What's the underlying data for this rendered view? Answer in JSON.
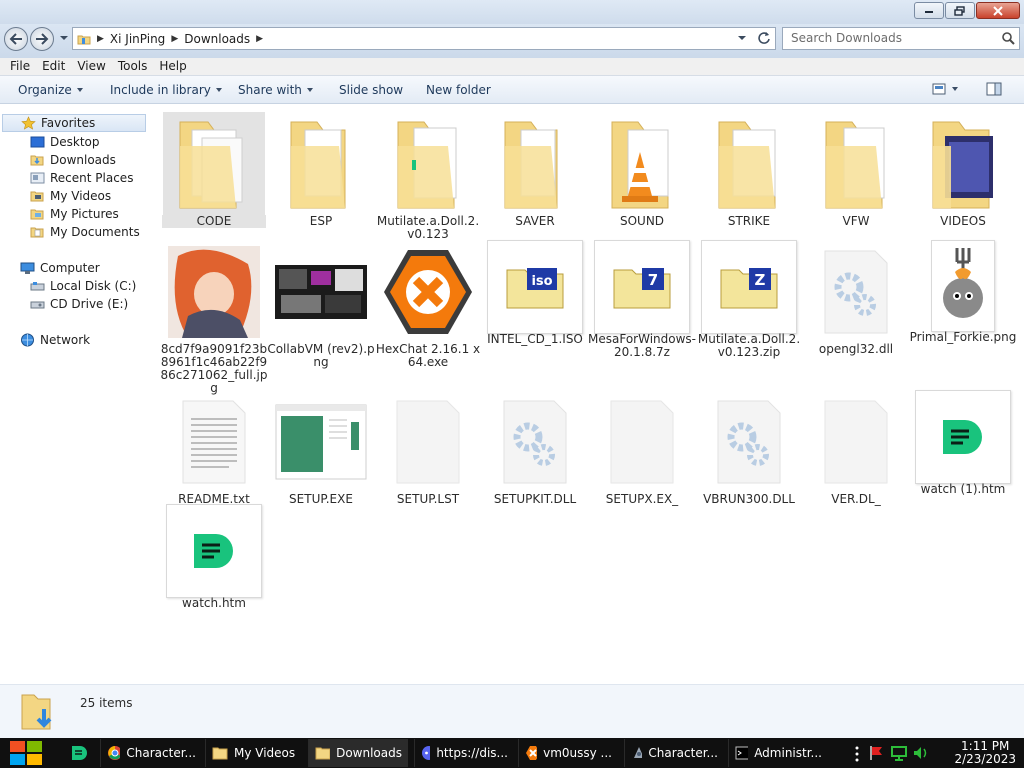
{
  "window": {
    "buttons": [
      "minimize",
      "restore",
      "close"
    ]
  },
  "address": {
    "crumbs": [
      "Xi JinPing",
      "Downloads"
    ],
    "search_placeholder": "Search Downloads"
  },
  "menu": [
    "File",
    "Edit",
    "View",
    "Tools",
    "Help"
  ],
  "commands": {
    "organize": "Organize",
    "include": "Include in library",
    "share": "Share with",
    "slideshow": "Slide show",
    "newfolder": "New folder"
  },
  "nav": {
    "favorites": "Favorites",
    "desktop": "Desktop",
    "downloads": "Downloads",
    "recent": "Recent Places",
    "videos": "My Videos",
    "pictures": "My Pictures",
    "documents": "My Documents",
    "computer": "Computer",
    "localdisk": "Local Disk (C:)",
    "cddrive": "CD Drive (E:)",
    "network": "Network"
  },
  "files": [
    {
      "name": "CODE",
      "icon": "folder-icon"
    },
    {
      "name": "ESP",
      "icon": "folder-icon"
    },
    {
      "name": "Mutilate.a.Doll.2.v0.123",
      "icon": "folder-icon"
    },
    {
      "name": "SAVER",
      "icon": "folder-icon"
    },
    {
      "name": "SOUND",
      "icon": "folder-vlc-icon"
    },
    {
      "name": "STRIKE",
      "icon": "folder-icon"
    },
    {
      "name": "VFW",
      "icon": "folder-icon"
    },
    {
      "name": "VIDEOS",
      "icon": "folder-video-icon"
    },
    {
      "name": "8cd7f9a9091f23b8961f1c46ab22f986c271062_full.jpg",
      "icon": "image-thumbnail"
    },
    {
      "name": "CollabVM (rev2).png",
      "icon": "image-thumbnail"
    },
    {
      "name": "HexChat 2.16.1 x64.exe",
      "icon": "hexchat-icon"
    },
    {
      "name": "INTEL_CD_1.ISO",
      "icon": "iso-archive-icon"
    },
    {
      "name": "MesaForWindows-20.1.8.7z",
      "icon": "7z-archive-icon"
    },
    {
      "name": "Mutilate.a.Doll.2.v0.123.zip",
      "icon": "zip-archive-icon"
    },
    {
      "name": "opengl32.dll",
      "icon": "gear-file-icon"
    },
    {
      "name": "Primal_Forkie.png",
      "icon": "image-thumbnail"
    },
    {
      "name": "README.txt",
      "icon": "text-file-icon"
    },
    {
      "name": "SETUP.EXE",
      "icon": "installer-window-icon"
    },
    {
      "name": "SETUP.LST",
      "icon": "blank-file-icon"
    },
    {
      "name": "SETUPKIT.DLL",
      "icon": "gear-file-icon"
    },
    {
      "name": "SETUPX.EX_",
      "icon": "blank-file-icon"
    },
    {
      "name": "VBRUN300.DLL",
      "icon": "gear-file-icon"
    },
    {
      "name": "VER.DL_",
      "icon": "blank-file-icon"
    },
    {
      "name": "watch (1).htm",
      "icon": "green-chat-icon"
    },
    {
      "name": "watch.htm",
      "icon": "green-chat-icon"
    }
  ],
  "status": {
    "count": "25 items"
  },
  "taskbar": {
    "tasks": [
      {
        "label": "Character...",
        "icon": "chrome-icon"
      },
      {
        "label": "My Videos",
        "icon": "folder-icon"
      },
      {
        "label": "Downloads",
        "icon": "folder-icon"
      },
      {
        "label": "https://dis...",
        "icon": "discord-icon"
      },
      {
        "label": "vm0ussy ...",
        "icon": "hexchat-icon"
      },
      {
        "label": "Character...",
        "icon": "app-icon"
      },
      {
        "label": "Administr...",
        "icon": "cmd-icon"
      }
    ],
    "time": "1:11 PM",
    "date": "2/23/2023"
  },
  "colors": {
    "chrome_blue": "#cfdcec",
    "folder_yellow": "#f3d683",
    "chat_green": "#19c37d",
    "taskbar": "#101010"
  }
}
